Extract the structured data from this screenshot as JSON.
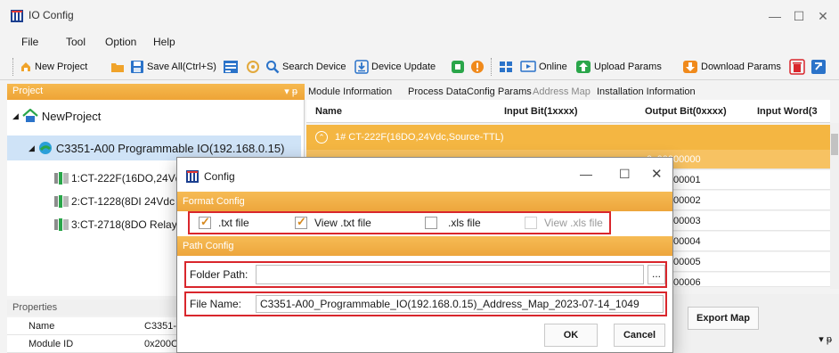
{
  "window": {
    "title": "IO Config",
    "controls": [
      "—",
      "☐",
      "✕"
    ]
  },
  "menu": [
    "File",
    "Tool",
    "Option",
    "Help"
  ],
  "toolbar": {
    "new_project": "New Project",
    "save_all": "Save All(Ctrl+S)",
    "search_device": "Search Device",
    "device_update": "Device Update",
    "online": "Online",
    "upload_params": "Upload Params",
    "download_params": "Download Params"
  },
  "project_panel": {
    "header": "Project",
    "pin": "▾ ᵽ",
    "root": "NewProject",
    "device": "C3351-A00 Programmable IO(192.168.0.15)",
    "modules": [
      "1:CT-222F(16DO,24Vd",
      "2:CT-1228(8DI 24Vdc S",
      "3:CT-2718(8DO Relay ("
    ]
  },
  "properties": {
    "header": "Properties",
    "rows": [
      {
        "key": "Name",
        "value": "C3351-"
      },
      {
        "key": "Module ID",
        "value": "0x200C"
      }
    ]
  },
  "tabs": [
    "Module Information",
    "Process Data",
    "Config Params",
    "Address Map",
    "Installation Information"
  ],
  "grid": {
    "columns": [
      "Name",
      "Input Bit(1xxxx)",
      "Output Bit(0xxxx)",
      "Input Word(3"
    ],
    "group": "1# CT-222F(16DO,24Vdc,Source-TTL)",
    "output_bits": [
      "0x00000000",
      "00001",
      "00002",
      "00003",
      "00004",
      "00005",
      "00006"
    ],
    "export_button": "Export Map"
  },
  "dialog": {
    "title": "Config",
    "format_section": "Format Config",
    "options": [
      {
        "label": ".txt file",
        "checked": true,
        "enabled": true
      },
      {
        "label": "View .txt file",
        "checked": true,
        "enabled": true
      },
      {
        "label": ".xls file",
        "checked": false,
        "enabled": true
      },
      {
        "label": "View .xls file",
        "checked": false,
        "enabled": false
      }
    ],
    "path_section": "Path Config",
    "folder_label": "Folder Path:",
    "folder_value": "",
    "browse": "...",
    "file_label": "File Name:",
    "file_value": "C3351-A00_Programmable_IO(192.168.0.15)_Address_Map_2023-07-14_1049",
    "ok": "OK",
    "cancel": "Cancel"
  },
  "colors": {
    "accent_orange": "#f4b642",
    "highlight_red": "#d9262c",
    "selected_blue": "#cfe3f7"
  }
}
